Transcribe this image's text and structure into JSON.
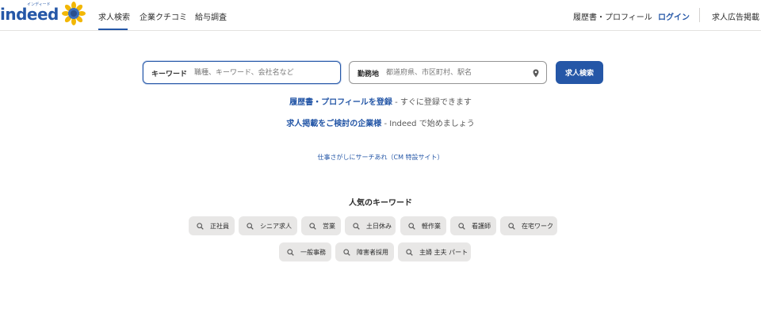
{
  "header": {
    "logo_text": "indeed",
    "logo_kana": "インディード",
    "nav": {
      "job_search": "求人検索",
      "company_reviews": "企業クチコミ",
      "salary": "給与調査"
    },
    "right": {
      "resume": "履歴書・プロフィール",
      "login": "ログイン",
      "post_job": "求人広告掲載"
    }
  },
  "search": {
    "what_label": "キーワード",
    "what_placeholder": "職種、キーワード、会社名など",
    "where_label": "勤務地",
    "where_placeholder": "都道府県、市区町村、駅名",
    "button": "求人検索"
  },
  "promos": {
    "resume_link": "履歴書・プロフィールを登録",
    "resume_text": " - すぐに登録できます",
    "employer_link": "求人掲載をご検討の企業様",
    "employer_text": " - Indeed で始めましょう",
    "cm_link": "仕事さがしにサーチあれ（CM 特設サイト）"
  },
  "popular": {
    "title": "人気のキーワード",
    "keywords": [
      "正社員",
      "シニア求人",
      "営業",
      "土日休み",
      "軽作業",
      "看護師",
      "在宅ワーク",
      "一般事務",
      "障害者採用",
      "主婦 主夫 パート"
    ]
  },
  "colors": {
    "brand": "#2557a7",
    "chip_bg": "#e8e7e6"
  }
}
